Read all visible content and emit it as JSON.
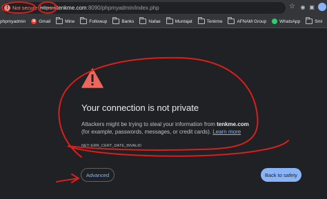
{
  "address_bar": {
    "security_label": "Not secure",
    "security_icon": "warning-icon",
    "url_scheme": "https://",
    "url_host": "tenkme.com",
    "url_path": ":8090/phpmyadmin/index.php"
  },
  "bookmarks": [
    {
      "label": "phpmyadmin",
      "icon": "none"
    },
    {
      "label": "Gmail",
      "icon": "gmail-icon"
    },
    {
      "label": "Mine",
      "icon": "folder-icon"
    },
    {
      "label": "Followup",
      "icon": "folder-icon"
    },
    {
      "label": "Banks",
      "icon": "folder-icon"
    },
    {
      "label": "Nafae",
      "icon": "folder-icon"
    },
    {
      "label": "Muntajat",
      "icon": "folder-icon"
    },
    {
      "label": "Tenkme",
      "icon": "folder-icon"
    },
    {
      "label": "AFNAM Group",
      "icon": "folder-icon"
    },
    {
      "label": "WhatsApp",
      "icon": "whatsapp-icon"
    },
    {
      "label": "Smi",
      "icon": "folder-icon"
    }
  ],
  "interstitial": {
    "title": "Your connection is not private",
    "desc_prefix": "Attackers might be trying to steal your information from ",
    "desc_domain": "tenkme.com",
    "desc_suffix": " (for example, passwords, messages, or credit cards). ",
    "learn_more": "Learn more",
    "error_code": "NET::ERR_CERT_DATE_INVALID",
    "advanced_label": "Advanced",
    "back_label": "Back to safety"
  },
  "colors": {
    "page_bg": "#202124",
    "warning_red": "#ee675c",
    "annotation_red": "#d9201c",
    "link_blue": "#8ab4f8"
  }
}
